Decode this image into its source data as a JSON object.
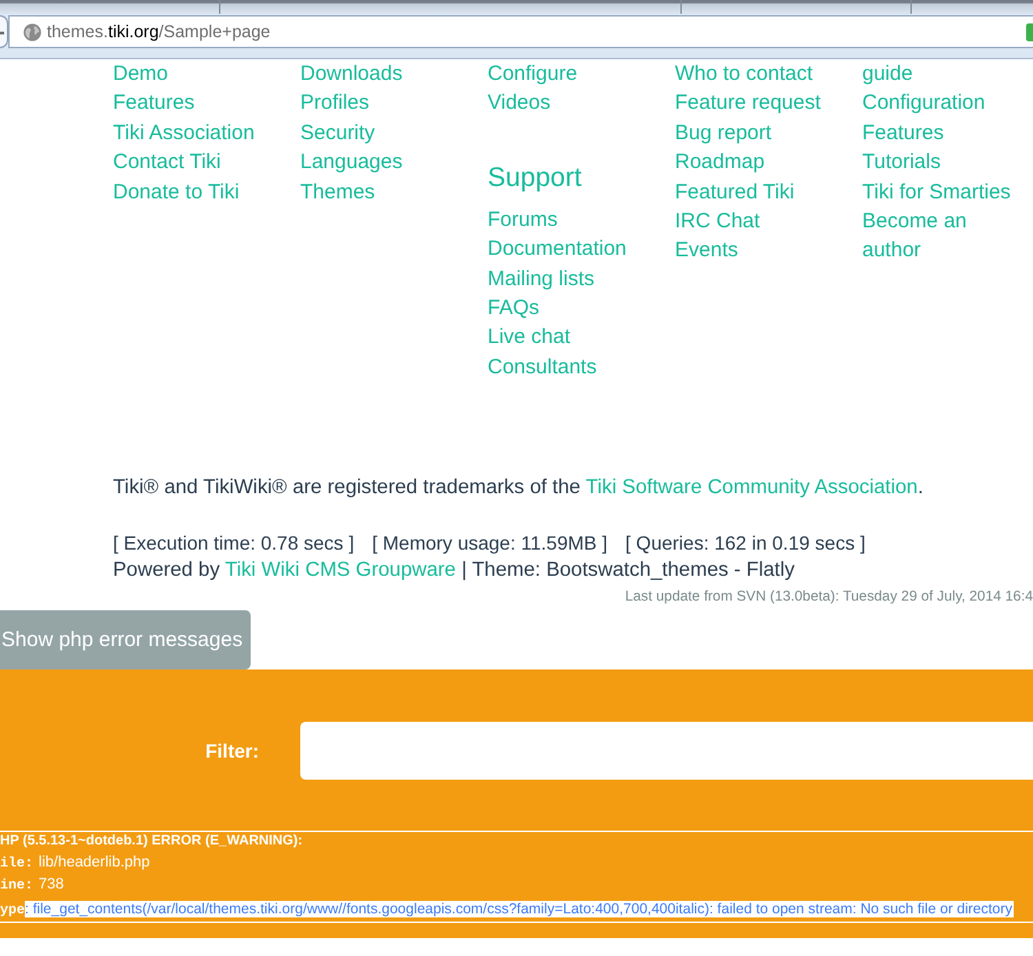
{
  "browser": {
    "url_parts": [
      {
        "text": "themes.",
        "kind": "dim"
      },
      {
        "text": "tiki.org",
        "kind": "domain"
      },
      {
        "text": "/Sample+page",
        "kind": "dim"
      }
    ]
  },
  "nav_columns": [
    {
      "items": [
        {
          "kind": "link",
          "text": "Demo"
        },
        {
          "kind": "link",
          "text": "Features"
        },
        {
          "kind": "link",
          "text": "Tiki Association"
        },
        {
          "kind": "link",
          "text": "Contact Tiki"
        },
        {
          "kind": "link",
          "text": "Donate to Tiki"
        }
      ]
    },
    {
      "items": [
        {
          "kind": "link",
          "text": "Downloads"
        },
        {
          "kind": "link",
          "text": "Profiles"
        },
        {
          "kind": "link",
          "text": "Security"
        },
        {
          "kind": "link",
          "text": "Languages"
        },
        {
          "kind": "link",
          "text": "Themes"
        }
      ]
    },
    {
      "items": [
        {
          "kind": "link",
          "text": "Configure"
        },
        {
          "kind": "link",
          "text": "Videos"
        },
        {
          "kind": "heading",
          "text": "Support"
        },
        {
          "kind": "link",
          "text": "Forums"
        },
        {
          "kind": "link",
          "text": "Documentation"
        },
        {
          "kind": "link",
          "text": "Mailing lists"
        },
        {
          "kind": "link",
          "text": "FAQs"
        },
        {
          "kind": "link",
          "text": "Live chat"
        },
        {
          "kind": "link",
          "text": "Consultants"
        }
      ]
    },
    {
      "items": [
        {
          "kind": "link",
          "text": "Who to contact"
        },
        {
          "kind": "link",
          "text": "Feature request"
        },
        {
          "kind": "link",
          "text": "Bug report"
        },
        {
          "kind": "link",
          "text": "Roadmap"
        },
        {
          "kind": "link",
          "text": "Featured Tiki"
        },
        {
          "kind": "link",
          "text": "IRC Chat"
        },
        {
          "kind": "link",
          "text": "Events"
        }
      ]
    },
    {
      "items": [
        {
          "kind": "link",
          "text": "guide"
        },
        {
          "kind": "link",
          "text": "Configuration"
        },
        {
          "kind": "link",
          "text": "Features"
        },
        {
          "kind": "link",
          "text": "Tutorials"
        },
        {
          "kind": "link",
          "text": "Tiki for Smarties"
        },
        {
          "kind": "link",
          "text": "Become an author"
        }
      ]
    }
  ],
  "footer": {
    "trademark": {
      "text": "Tiki® and TikiWiki® are registered trademarks of the",
      "link": "Tiki Software Community Association",
      "end": "."
    },
    "stats": [
      "[ Execution time: 0.78 secs ]",
      "[ Memory usage: 11.59MB ]",
      "[ Queries: 162 in 0.19 secs ]"
    ],
    "powered": {
      "prefix": "Powered by",
      "link": "Tiki Wiki CMS Groupware",
      "suffix": "| Theme: Bootswatch_themes - Flatly"
    },
    "last_update": "Last update from SVN (13.0beta): Tuesday 29 of July, 2014 16:4"
  },
  "error_toggle": {
    "label": "Show php error messages"
  },
  "filter": {
    "label": "Filter:"
  },
  "php_error": {
    "heading": "HP (5.5.13-1~dotdeb.1) ERROR (E_WARNING):",
    "fields": [
      {
        "kind": "plain",
        "label": "ile:",
        "value": "lib/headerlib.php"
      },
      {
        "kind": "plain",
        "label": "ine:",
        "value": "738"
      },
      {
        "kind": "highlight",
        "label": "ype",
        "value": ": file_get_contents(/var/local/themes.tiki.org/www//fonts.googleapis.com/css?family=Lato:400,700,400italic): failed to open stream: No such file or directory"
      }
    ]
  }
}
